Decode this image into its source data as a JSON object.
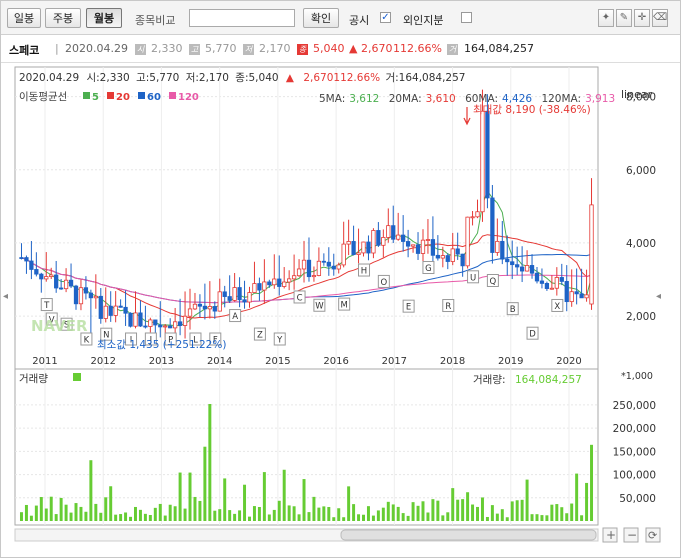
{
  "toolbar": {
    "buttons": [
      "일봉",
      "주봉",
      "월봉"
    ],
    "active": "월봉",
    "compare_label": "종목비교",
    "compare_value": "",
    "confirm_label": "확인",
    "gongsi_label": "공시",
    "gongsi_checked": true,
    "foreign_label": "외인지분",
    "foreign_checked": false
  },
  "info": {
    "name": "스페코",
    "date": "2020.04.29",
    "open": "2,330",
    "high": "5,770",
    "low": "2,170",
    "close": "5,040",
    "change": "▲ 2,670",
    "change_pct": "112.66%",
    "volume": "164,084,257"
  },
  "price_info": {
    "date": "2020.04.29",
    "open_label": "시:",
    "open": "2,330",
    "high_label": "고:",
    "high": "5,770",
    "low_label": "저:",
    "low": "2,170",
    "close_label": "종:",
    "close": "5,040",
    "change": "▲",
    "change_val": "2,670112.66%",
    "vol_label": "거:",
    "vol": "164,084,257"
  },
  "ma_legend": {
    "title": "이동평균선",
    "items": [
      {
        "label": "5",
        "color": "#4caf50"
      },
      {
        "label": "20",
        "color": "#e53935"
      },
      {
        "label": "60",
        "color": "#1e63c6"
      },
      {
        "label": "120",
        "color": "#e85aa8"
      }
    ]
  },
  "ma_values": {
    "ma5_label": "5MA:",
    "ma5": "3,612",
    "ma20_label": "20MA:",
    "ma20": "3,610",
    "ma60_label": "60MA:",
    "ma60": "4,426",
    "ma120_label": "120MA:",
    "ma120": "3,913"
  },
  "scale_label": "linear",
  "max_annotation": "최대값 8,190 (-38.46%)",
  "min_annotation": "최소값 1,435 (+251.22%)",
  "volume_title": "거래량",
  "volume_value_label": "거래량:",
  "volume_value": "164,084,257",
  "volume_multiplier": "*1,000",
  "colors": {
    "up": "#e53935",
    "down": "#1e63c6",
    "volume": "#66cc33"
  },
  "watermark": "NAVER",
  "chart_data": {
    "type": "candlestick",
    "x_labels": [
      "2011",
      "2012",
      "2013",
      "2014",
      "2015",
      "2016",
      "2017",
      "2018",
      "2019",
      "2020"
    ],
    "price_ticks": [
      "2,000",
      "4,000",
      "6,000",
      "8,000"
    ],
    "price_range": [
      1100,
      8700
    ],
    "volume_ticks": [
      "50,000",
      "100,000",
      "150,000",
      "200,000",
      "250,000"
    ],
    "volume_range": [
      0,
      280000
    ],
    "y_scale": "linear",
    "last_candle": {
      "date": "2020.04.29",
      "open": 2330,
      "high": 5770,
      "low": 2170,
      "close": 5040,
      "volume": 164084257
    },
    "markers": [
      "T",
      "S",
      "K",
      "N",
      "I",
      "J",
      "P",
      "L",
      "F",
      "A",
      "Z",
      "Y",
      "C",
      "W",
      "M",
      "H",
      "O",
      "E",
      "G",
      "R",
      "U",
      "Q",
      "B",
      "D",
      "X",
      "V"
    ]
  }
}
